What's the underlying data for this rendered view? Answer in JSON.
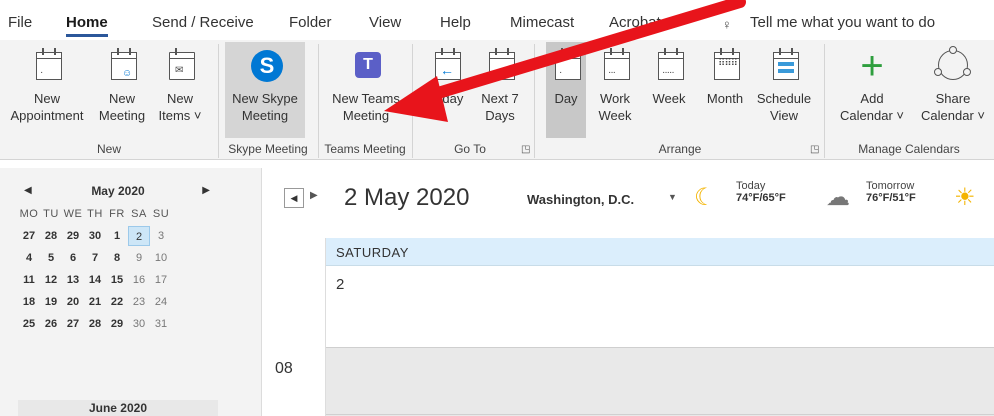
{
  "menu": {
    "tabs": [
      "File",
      "Home",
      "Send / Receive",
      "Folder",
      "View",
      "Help",
      "Mimecast",
      "Acrobat"
    ],
    "tell_me": "Tell me what you want to do"
  },
  "ribbon": {
    "new_appointment": [
      "New",
      "Appointment"
    ],
    "new_meeting": [
      "New",
      "Meeting"
    ],
    "new_items": [
      "New",
      "Items ˅"
    ],
    "new_skype": [
      "New Skype",
      "Meeting"
    ],
    "new_teams": [
      "New Teams",
      "Meeting"
    ],
    "today": [
      "Today",
      ""
    ],
    "next7": [
      "Next 7",
      "Days"
    ],
    "day": [
      "Day",
      ""
    ],
    "work_week": [
      "Work",
      "Week"
    ],
    "week": [
      "Week",
      ""
    ],
    "month": [
      "Month",
      ""
    ],
    "schedule_view": [
      "Schedule",
      "View"
    ],
    "add_calendar": [
      "Add",
      "Calendar ˅"
    ],
    "share_calendar": [
      "Share",
      "Calendar ˅"
    ],
    "groups": {
      "new": "New",
      "skype": "Skype Meeting",
      "teams": "Teams Meeting",
      "goto": "Go To",
      "arrange": "Arrange",
      "manage": "Manage Calendars"
    }
  },
  "minical": {
    "month": "May 2020",
    "dows": [
      "MO",
      "TU",
      "WE",
      "TH",
      "FR",
      "SA",
      "SU"
    ],
    "weeks": [
      [
        "27",
        "28",
        "29",
        "30",
        "1",
        "2",
        "3"
      ],
      [
        "4",
        "5",
        "6",
        "7",
        "8",
        "9",
        "10"
      ],
      [
        "11",
        "12",
        "13",
        "14",
        "15",
        "16",
        "17"
      ],
      [
        "18",
        "19",
        "20",
        "21",
        "22",
        "23",
        "24"
      ],
      [
        "25",
        "26",
        "27",
        "28",
        "29",
        "30",
        "31"
      ]
    ],
    "next_month": "June 2020"
  },
  "view": {
    "date": "2 May 2020",
    "location": "Washington, D.C.",
    "today_label": "Today",
    "today_temp": "74°F/65°F",
    "tomorrow_label": "Tomorrow",
    "tomorrow_temp": "76°F/51°F",
    "day_name": "SATURDAY",
    "day_number": "2",
    "hour": "08"
  },
  "colors": {
    "accent": "#2b579a",
    "selected_day": "#cde6f7",
    "day_header": "#dbeefc",
    "annotation": "#e8141b"
  }
}
